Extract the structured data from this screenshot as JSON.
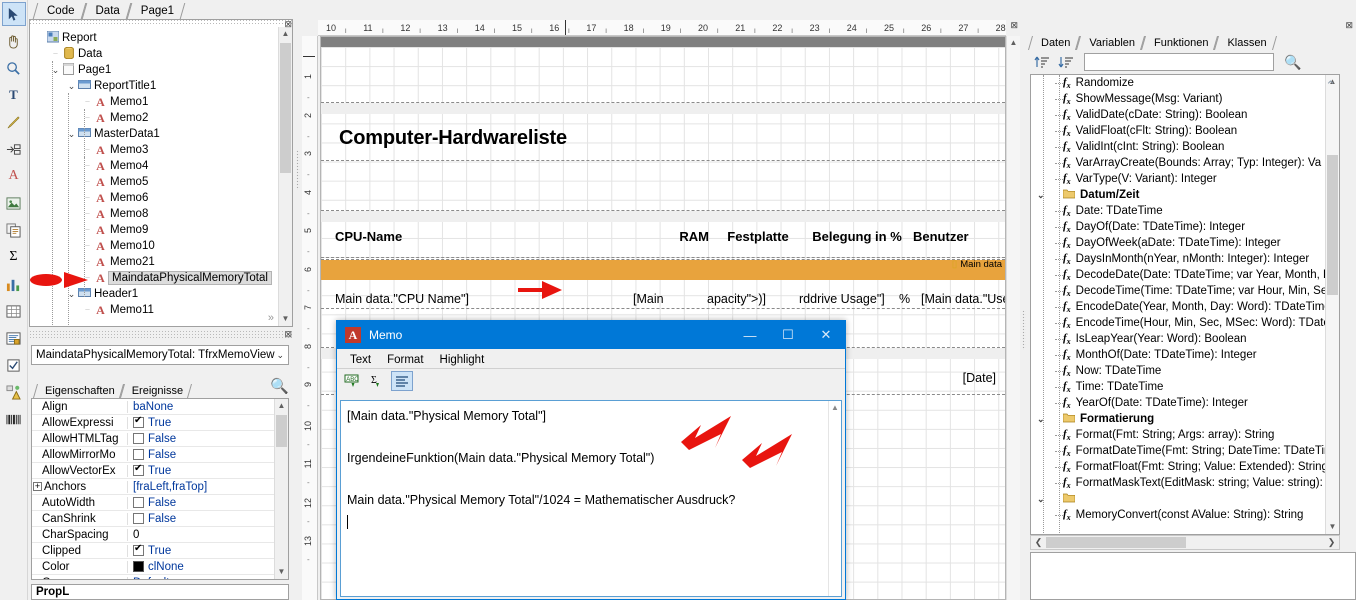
{
  "left_toolbar": {
    "tools": [
      {
        "name": "select-pointer-tool",
        "glyph": "➤",
        "selected": true
      },
      {
        "name": "hand-pan-tool",
        "glyph": "✋",
        "selected": false
      },
      {
        "name": "zoom-tool",
        "glyph": "🔍",
        "selected": false
      },
      {
        "name": "text-tool",
        "glyph": "T",
        "selected": false
      },
      {
        "name": "format-painter-tool",
        "glyph": "🖌",
        "selected": false
      },
      {
        "name": "insert-band-tool",
        "glyph": "⇥",
        "selected": false
      },
      {
        "name": "memo-object-tool",
        "glyph": "A",
        "selected": false
      },
      {
        "name": "picture-object-tool",
        "glyph": "🖼",
        "selected": false
      },
      {
        "name": "subreport-object-tool",
        "glyph": "❐",
        "selected": false
      },
      {
        "name": "aggregate-object-tool",
        "glyph": "Σ",
        "selected": false
      },
      {
        "name": "chart-object-tool",
        "glyph": "📊",
        "selected": false
      },
      {
        "name": "table-object-tool",
        "glyph": "▦",
        "selected": false
      },
      {
        "name": "richtext-object-tool",
        "glyph": "▤",
        "selected": false
      },
      {
        "name": "checkbox-object-tool",
        "glyph": "☑",
        "selected": false
      },
      {
        "name": "shape-object-tool",
        "glyph": "▲",
        "selected": false
      },
      {
        "name": "barcode-object-tool",
        "glyph": "▥",
        "selected": false
      }
    ]
  },
  "top_tabs": [
    {
      "label": "Code",
      "active": false
    },
    {
      "label": "Data",
      "active": false
    },
    {
      "label": "Page1",
      "active": true
    }
  ],
  "tree": {
    "nodes": [
      {
        "label": "Report",
        "depth": 0,
        "icon": "report-icon",
        "expander": "",
        "selected": false
      },
      {
        "label": "Data",
        "depth": 1,
        "icon": "data-icon",
        "expander": "",
        "selected": false
      },
      {
        "label": "Page1",
        "depth": 1,
        "icon": "page-icon",
        "expander": "v",
        "selected": false
      },
      {
        "label": "ReportTitle1",
        "depth": 2,
        "icon": "band-icon",
        "expander": "v",
        "selected": false
      },
      {
        "label": "Memo1",
        "depth": 3,
        "icon": "memo-icon",
        "expander": "",
        "selected": false
      },
      {
        "label": "Memo2",
        "depth": 3,
        "icon": "memo-icon",
        "expander": "",
        "selected": false
      },
      {
        "label": "MasterData1",
        "depth": 2,
        "icon": "band-icon",
        "expander": "v",
        "selected": false
      },
      {
        "label": "Memo3",
        "depth": 3,
        "icon": "memo-icon",
        "expander": "",
        "selected": false
      },
      {
        "label": "Memo4",
        "depth": 3,
        "icon": "memo-icon",
        "expander": "",
        "selected": false
      },
      {
        "label": "Memo5",
        "depth": 3,
        "icon": "memo-icon",
        "expander": "",
        "selected": false
      },
      {
        "label": "Memo6",
        "depth": 3,
        "icon": "memo-icon",
        "expander": "",
        "selected": false
      },
      {
        "label": "Memo8",
        "depth": 3,
        "icon": "memo-icon",
        "expander": "",
        "selected": false
      },
      {
        "label": "Memo9",
        "depth": 3,
        "icon": "memo-icon",
        "expander": "",
        "selected": false
      },
      {
        "label": "Memo10",
        "depth": 3,
        "icon": "memo-icon",
        "expander": "",
        "selected": false
      },
      {
        "label": "Memo21",
        "depth": 3,
        "icon": "memo-icon",
        "expander": "",
        "selected": false
      },
      {
        "label": "MaindataPhysicalMemoryTotal",
        "depth": 3,
        "icon": "memo-icon",
        "expander": "",
        "selected": true
      },
      {
        "label": "Header1",
        "depth": 2,
        "icon": "band-icon",
        "expander": "v",
        "selected": false
      },
      {
        "label": "Memo11",
        "depth": 3,
        "icon": "memo-icon",
        "expander": "",
        "selected": false
      }
    ]
  },
  "object_selector": {
    "value": "MaindataPhysicalMemoryTotal: TfrxMemoView",
    "caret": "⌄"
  },
  "props_tabs": [
    {
      "label": "Eigenschaften",
      "active": true
    },
    {
      "label": "Ereignisse",
      "active": false
    }
  ],
  "properties": [
    {
      "name": "Align",
      "value": "baNone",
      "type": "text",
      "expandable": false
    },
    {
      "name": "AllowExpressi",
      "value": "True",
      "type": "check",
      "checked": true,
      "expandable": false
    },
    {
      "name": "AllowHTMLTag",
      "value": "False",
      "type": "check",
      "checked": false,
      "expandable": false
    },
    {
      "name": "AllowMirrorMo",
      "value": "False",
      "type": "check",
      "checked": false,
      "expandable": false
    },
    {
      "name": "AllowVectorEx",
      "value": "True",
      "type": "check",
      "checked": true,
      "expandable": false
    },
    {
      "name": "Anchors",
      "value": "[fraLeft,fraTop]",
      "type": "text",
      "expandable": true
    },
    {
      "name": "AutoWidth",
      "value": "False",
      "type": "check",
      "checked": false,
      "expandable": false
    },
    {
      "name": "CanShrink",
      "value": "False",
      "type": "check",
      "checked": false,
      "expandable": false
    },
    {
      "name": "CharSpacing",
      "value": "0",
      "type": "plain",
      "expandable": false
    },
    {
      "name": "Clipped",
      "value": "True",
      "type": "check",
      "checked": true,
      "expandable": false
    },
    {
      "name": "Color",
      "value": "clNone",
      "type": "color",
      "swatch": "#000000",
      "expandable": false
    },
    {
      "name": "C",
      "value": "Default",
      "type": "text",
      "expandable": false
    }
  ],
  "prop_footer": {
    "label": "PropL"
  },
  "canvas": {
    "hruler_ticks": [
      "10",
      "11",
      "12",
      "13",
      "14",
      "15",
      "16",
      "17",
      "18",
      "19",
      "20",
      "21",
      "22",
      "23",
      "24",
      "25",
      "26",
      "27",
      "28"
    ],
    "vruler_ticks": [
      "1",
      "2",
      "3",
      "4",
      "5",
      "6",
      "7",
      "8",
      "9",
      "10",
      "11",
      "12",
      "13"
    ],
    "report_title": "Computer-Hardwareliste",
    "header_columns": [
      {
        "label": "CPU-Name"
      },
      {
        "label": "RAM"
      },
      {
        "label": "Festplatte"
      },
      {
        "label": "Belegung in %"
      },
      {
        "label": "Benutzer"
      }
    ],
    "band_tag": "Main data",
    "data_fields": [
      {
        "label": "Main data.\"CPU Name\"]"
      },
      {
        "label": "[Main"
      },
      {
        "label": "apacity\">)]"
      },
      {
        "label": "rddrive Usage\"]"
      },
      {
        "label": "%"
      },
      {
        "label": "[Main data.\"Use"
      }
    ],
    "footer_field": "[Date]"
  },
  "memo_dialog": {
    "title": "Memo",
    "icon_letter": "A",
    "window_buttons": [
      {
        "name": "minimize-button",
        "glyph": "—"
      },
      {
        "name": "maximize-button",
        "glyph": "☐"
      },
      {
        "name": "close-button",
        "glyph": "✕"
      }
    ],
    "tabs": [
      {
        "label": "Text",
        "active": true
      },
      {
        "label": "Format",
        "active": false
      },
      {
        "label": "Highlight",
        "active": false
      }
    ],
    "toolbar": [
      {
        "name": "insert-data-field-button",
        "glyph": "🔤"
      },
      {
        "name": "insert-aggregate-button",
        "glyph": "Σ"
      },
      {
        "name": "text-alignment-button",
        "glyph": "≡",
        "active": true
      }
    ],
    "text_lines": [
      "[Main data.\"Physical Memory Total\"]",
      "",
      "IrgendeineFunktion(Main data.\"Physical Memory Total\")",
      "",
      "Main data.\"Physical Memory Total\"/1024 = Mathematischer Ausdruck?"
    ]
  },
  "right_panel": {
    "tabs": [
      {
        "label": "Daten",
        "active": false
      },
      {
        "label": "Variablen",
        "active": false
      },
      {
        "label": "Funktionen",
        "active": true
      },
      {
        "label": "Klassen",
        "active": false
      }
    ],
    "toolbar": [
      {
        "name": "sort-ascending-button",
        "glyph": "↑"
      },
      {
        "name": "sort-descending-button",
        "glyph": "↓"
      }
    ],
    "search_value": "",
    "functions": [
      {
        "label": "Randomize",
        "type": "fn"
      },
      {
        "label": "ShowMessage(Msg: Variant)",
        "type": "fn"
      },
      {
        "label": "ValidDate(cDate: String): Boolean",
        "type": "fn"
      },
      {
        "label": "ValidFloat(cFlt: String): Boolean",
        "type": "fn"
      },
      {
        "label": "ValidInt(cInt: String): Boolean",
        "type": "fn"
      },
      {
        "label": "VarArrayCreate(Bounds: Array; Typ: Integer): Va",
        "type": "fn"
      },
      {
        "label": "VarType(V: Variant): Integer",
        "type": "fn"
      },
      {
        "label": "Datum/Zeit",
        "type": "folder",
        "expander": "v"
      },
      {
        "label": "Date: TDateTime",
        "type": "fn"
      },
      {
        "label": "DayOf(Date: TDateTime): Integer",
        "type": "fn"
      },
      {
        "label": "DayOfWeek(aDate: TDateTime): Integer",
        "type": "fn"
      },
      {
        "label": "DaysInMonth(nYear, nMonth: Integer): Integer",
        "type": "fn"
      },
      {
        "label": "DecodeDate(Date: TDateTime; var Year, Month, D",
        "type": "fn"
      },
      {
        "label": "DecodeTime(Time: TDateTime; var Hour, Min, Sec",
        "type": "fn"
      },
      {
        "label": "EncodeDate(Year, Month, Day: Word): TDateTime",
        "type": "fn"
      },
      {
        "label": "EncodeTime(Hour, Min, Sec, MSec: Word): TDateT",
        "type": "fn"
      },
      {
        "label": "IsLeapYear(Year: Word): Boolean",
        "type": "fn"
      },
      {
        "label": "MonthOf(Date: TDateTime): Integer",
        "type": "fn"
      },
      {
        "label": "Now: TDateTime",
        "type": "fn"
      },
      {
        "label": "Time: TDateTime",
        "type": "fn"
      },
      {
        "label": "YearOf(Date: TDateTime): Integer",
        "type": "fn"
      },
      {
        "label": "Formatierung",
        "type": "folder",
        "expander": "v"
      },
      {
        "label": "Format(Fmt: String; Args: array): String",
        "type": "fn"
      },
      {
        "label": "FormatDateTime(Fmt: String; DateTime: TDateTim",
        "type": "fn"
      },
      {
        "label": "FormatFloat(Fmt: String; Value: Extended): String",
        "type": "fn"
      },
      {
        "label": "FormatMaskText(EditMask: string; Value: string):",
        "type": "fn"
      },
      {
        "label": "",
        "type": "folder",
        "expander": "v"
      },
      {
        "label": "MemoryConvert(const AValue: String): String",
        "type": "fn"
      }
    ]
  },
  "colors": {
    "accent_blue": "#0078d7",
    "band_orange": "#e8a33d",
    "arrow_red": "#e8150f",
    "selection_gray": "#dcdcdc"
  }
}
